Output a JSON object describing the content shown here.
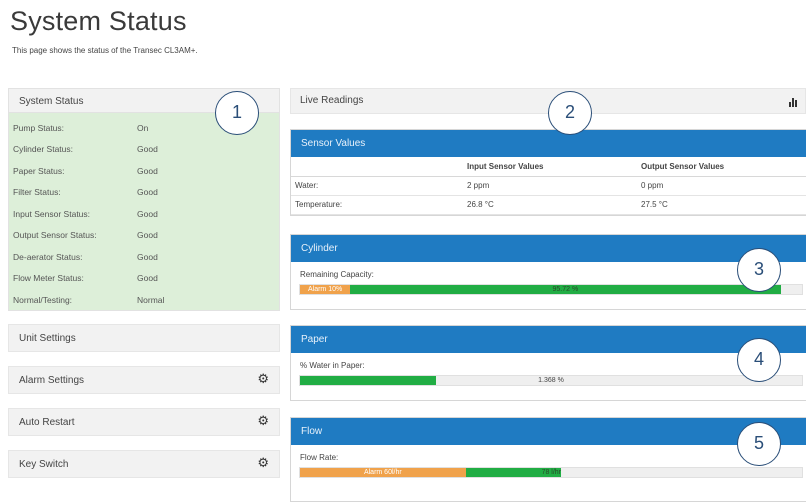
{
  "page": {
    "title": "System Status",
    "subtitle": "This page shows the status of the Transec CL3AM+."
  },
  "status_panel": {
    "heading": "System Status",
    "rows": [
      {
        "label": "Pump Status:",
        "value": "On"
      },
      {
        "label": "Cylinder Status:",
        "value": "Good"
      },
      {
        "label": "Paper Status:",
        "value": "Good"
      },
      {
        "label": "Filter Status:",
        "value": "Good"
      },
      {
        "label": "Input Sensor Status:",
        "value": "Good"
      },
      {
        "label": "Output Sensor Status:",
        "value": "Good"
      },
      {
        "label": "De-aerator Status:",
        "value": "Good"
      },
      {
        "label": "Flow Meter Status:",
        "value": "Good"
      },
      {
        "label": "Normal/Testing:",
        "value": "Normal"
      }
    ]
  },
  "settings": {
    "unit_settings": "Unit Settings",
    "alarm_settings": "Alarm Settings",
    "auto_restart": "Auto Restart",
    "key_switch": "Key Switch",
    "gear_icon": "gear-icon"
  },
  "live": {
    "heading": "Live Readings",
    "chart_icon": "bar-chart-icon"
  },
  "sensor": {
    "heading": "Sensor Values",
    "col_input": "Input Sensor Values",
    "col_output": "Output Sensor Values",
    "rows": [
      {
        "label": "Water:",
        "input": "2 ppm",
        "output": "0 ppm"
      },
      {
        "label": "Temperature:",
        "input": "26.8 °C",
        "output": "27.5 °C"
      }
    ]
  },
  "cylinder": {
    "heading": "Cylinder",
    "label": "Remaining Capacity:",
    "alarm_text": "Alarm 10%",
    "alarm_fraction": 0.1,
    "value_text": "95.72 %",
    "value_fraction": 0.9572
  },
  "paper": {
    "heading": "Paper",
    "label": "% Water in Paper:",
    "value_text": "1.368 %",
    "fill_fraction": 0.27
  },
  "flow": {
    "heading": "Flow",
    "label": "Flow Rate:",
    "alarm_text": "Alarm 60l/hr",
    "alarm_fraction": 0.33,
    "value_text": "78 l/hr",
    "value_fraction": 0.52
  },
  "callouts": [
    "1",
    "2",
    "3",
    "4",
    "5"
  ],
  "colors": {
    "header_blue": "#1f7bc2",
    "status_green": "#ddefd9",
    "progress_green": "#21ad44",
    "alarm_orange": "#f0a24b",
    "callout_navy": "#2a4e78"
  }
}
